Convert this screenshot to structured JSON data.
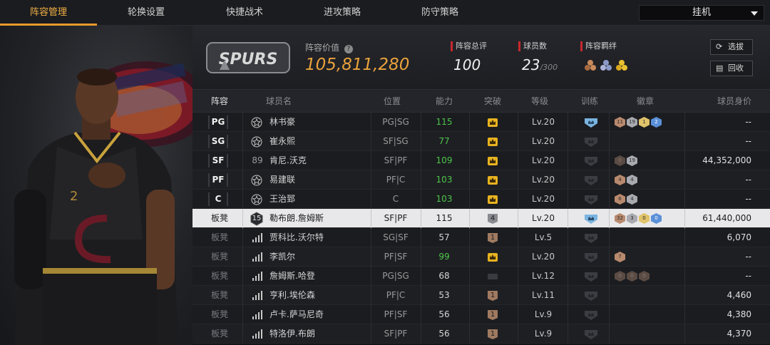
{
  "tabs": [
    {
      "label": "阵容管理",
      "active": true
    },
    {
      "label": "轮换设置",
      "active": false
    },
    {
      "label": "快捷战术",
      "active": false
    },
    {
      "label": "进攻策略",
      "active": false
    },
    {
      "label": "防守策略",
      "active": false
    }
  ],
  "mode_select": {
    "value": "挂机"
  },
  "header": {
    "team_logo_text": "SPURS",
    "lineup_value_label": "阵容价值",
    "lineup_value": "105,811,280",
    "overall_label": "阵容总评",
    "overall_value": "100",
    "player_count_label": "球员数",
    "player_count_value": "23",
    "player_count_max": "/300",
    "bonds_label": "阵容羁绊",
    "bond_icons": [
      "bond-bronze-icon",
      "bond-silver-icon",
      "bond-gold-icon"
    ],
    "buttons": {
      "pick": "选拔",
      "recycle": "回收"
    }
  },
  "columns": [
    "阵容",
    "球员名",
    "位置",
    "能力",
    "突破",
    "等级",
    "训练",
    "徽章",
    "球员身价"
  ],
  "colors": {
    "accent": "#e89a2c",
    "value": "#e9a23b",
    "green": "#4cc64a",
    "red": "#c8282e"
  },
  "rows": [
    {
      "slot": "PG",
      "bench": false,
      "rank_icon": "star-icon",
      "rank_text": "",
      "name": "林书豪",
      "pos": "PG|SG",
      "ability": "115",
      "ability_green": true,
      "breakthrough": "crown",
      "breakthrough_text": "",
      "level": "Lv.20",
      "training": "blue",
      "badges": [
        {
          "t": "b-bronze",
          "v": "11"
        },
        {
          "t": "b-silver",
          "v": "19"
        },
        {
          "t": "b-gold",
          "v": "1"
        },
        {
          "t": "b-hof",
          "v": "2"
        }
      ],
      "price": "--"
    },
    {
      "slot": "SG",
      "bench": false,
      "rank_icon": "star-icon",
      "rank_text": "",
      "name": "崔永熙",
      "pos": "SF|SG",
      "ability": "77",
      "ability_green": true,
      "breakthrough": "crown",
      "breakthrough_text": "",
      "level": "Lv.20",
      "training": "gray",
      "badges": [],
      "price": "--"
    },
    {
      "slot": "SF",
      "bench": false,
      "rank_icon": "",
      "rank_text": "89",
      "name": "肯尼.沃克",
      "pos": "SF|PF",
      "ability": "109",
      "ability_green": true,
      "breakthrough": "crown",
      "breakthrough_text": "",
      "level": "Lv.20",
      "training": "gray",
      "badges": [
        {
          "t": "b-dim",
          "v": "0"
        },
        {
          "t": "b-silver",
          "v": "19"
        }
      ],
      "price": "44,352,000"
    },
    {
      "slot": "PF",
      "bench": false,
      "rank_icon": "star-icon",
      "rank_text": "",
      "name": "易建联",
      "pos": "PF|C",
      "ability": "103",
      "ability_green": true,
      "breakthrough": "crown",
      "breakthrough_text": "",
      "level": "Lv.20",
      "training": "gray",
      "badges": [
        {
          "t": "b-bronze",
          "v": "4"
        },
        {
          "t": "b-silver",
          "v": "4"
        }
      ],
      "price": "--"
    },
    {
      "slot": "C",
      "bench": false,
      "rank_icon": "star-icon",
      "rank_text": "",
      "name": "王治郅",
      "pos": "C",
      "ability": "103",
      "ability_green": true,
      "breakthrough": "crown",
      "breakthrough_text": "",
      "level": "Lv.20",
      "training": "gray",
      "badges": [
        {
          "t": "b-bronze",
          "v": "6"
        },
        {
          "t": "b-silver",
          "v": "4"
        }
      ],
      "price": "--"
    },
    {
      "slot": "板凳",
      "bench": true,
      "selected": true,
      "rank_icon": "",
      "rank_text": "15",
      "name": "勒布朗.詹姆斯",
      "pos": "SF|PF",
      "ability": "115",
      "ability_green": false,
      "breakthrough": "num",
      "breakthrough_text": "4",
      "level": "Lv.20",
      "training": "blue",
      "badges": [
        {
          "t": "b-bronze",
          "v": "32"
        },
        {
          "t": "b-silver",
          "v": "3"
        },
        {
          "t": "b-gold",
          "v": "0"
        },
        {
          "t": "b-hof",
          "v": "0"
        }
      ],
      "price": "61,440,000"
    },
    {
      "slot": "板凳",
      "bench": true,
      "rank_icon": "bars-icon",
      "rank_text": "",
      "name": "贾科比.沃尔特",
      "pos": "SG|SF",
      "ability": "57",
      "ability_green": false,
      "breakthrough": "numbronze",
      "breakthrough_text": "1",
      "level": "Lv.5",
      "training": "gray",
      "badges": [],
      "price": "6,070"
    },
    {
      "slot": "板凳",
      "bench": true,
      "rank_icon": "bars-icon",
      "rank_text": "",
      "name": "李凯尔",
      "pos": "PF|SF",
      "ability": "99",
      "ability_green": true,
      "breakthrough": "crown",
      "breakthrough_text": "",
      "level": "Lv.20",
      "training": "gray",
      "badges": [
        {
          "t": "b-bronze",
          "v": "7"
        }
      ],
      "price": "--"
    },
    {
      "slot": "板凳",
      "bench": true,
      "rank_icon": "bars-icon",
      "rank_text": "",
      "name": "詹姆斯.哈登",
      "pos": "PG|SG",
      "ability": "68",
      "ability_green": false,
      "breakthrough": "dash",
      "breakthrough_text": "",
      "level": "Lv.12",
      "training": "gray",
      "badges": [
        {
          "t": "b-dim",
          "v": "0"
        },
        {
          "t": "b-dim",
          "v": "0"
        },
        {
          "t": "b-dim",
          "v": "0"
        }
      ],
      "price": "--"
    },
    {
      "slot": "板凳",
      "bench": true,
      "rank_icon": "bars-icon",
      "rank_text": "",
      "name": "亨利.埃伦森",
      "pos": "PF|C",
      "ability": "53",
      "ability_green": false,
      "breakthrough": "numbronze",
      "breakthrough_text": "1",
      "level": "Lv.11",
      "training": "gray",
      "badges": [],
      "price": "4,460"
    },
    {
      "slot": "板凳",
      "bench": true,
      "rank_icon": "bars-icon",
      "rank_text": "",
      "name": "卢卡.萨马尼奇",
      "pos": "PF|SF",
      "ability": "56",
      "ability_green": false,
      "breakthrough": "numbronze",
      "breakthrough_text": "1",
      "level": "Lv.9",
      "training": "gray",
      "badges": [],
      "price": "4,380"
    },
    {
      "slot": "板凳",
      "bench": true,
      "rank_icon": "bars-icon",
      "rank_text": "",
      "name": "特洛伊.布朗",
      "pos": "SF|PF",
      "ability": "56",
      "ability_green": false,
      "breakthrough": "numbronze",
      "breakthrough_text": "1",
      "level": "Lv.9",
      "training": "gray",
      "badges": [],
      "price": "4,370"
    }
  ]
}
